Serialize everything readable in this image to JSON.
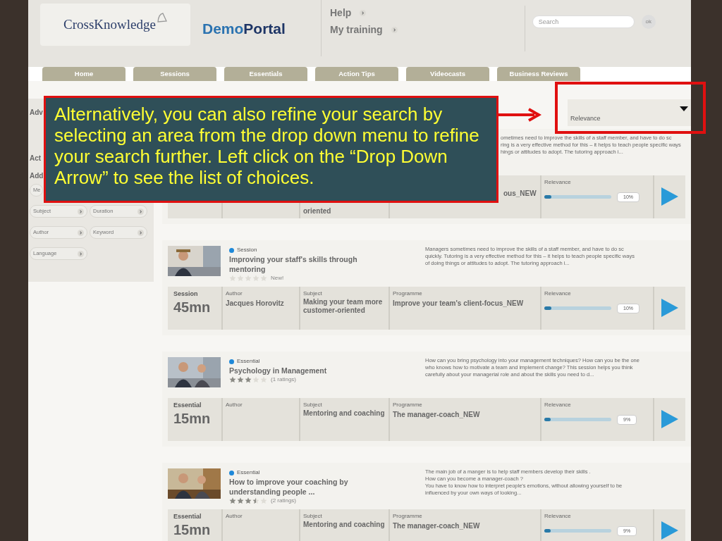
{
  "header": {
    "logo": "CrossKnowledge",
    "portal_name": [
      "Demo",
      "Portal"
    ],
    "links": [
      "Help",
      "My training"
    ],
    "search": {
      "placeholder": "Search"
    },
    "search_button": "ok"
  },
  "tabs": [
    {
      "label": "Home"
    },
    {
      "label": "Sessions"
    },
    {
      "label": "Essentials"
    },
    {
      "label": "Action Tips"
    },
    {
      "label": "Videocasts"
    },
    {
      "label": "Business Reviews"
    }
  ],
  "sidebar": {
    "headings": [
      "Adv",
      "Act",
      "Add"
    ],
    "filters": [
      [
        "Me"
      ],
      [
        "Subject",
        "Duration"
      ],
      [
        "Author",
        "Keyword"
      ],
      [
        "Language"
      ]
    ]
  },
  "sort": {
    "value": "Relevance"
  },
  "callout": "Alternatively, you can also refine your search by selecting an area from the drop down menu to refine your search further. Left click on the “Drop Down Arrow” to see the list of choices.",
  "results": [
    {
      "covered": true,
      "description": [
        "ometimes need to improve the skills of a staff member, and have to do sc",
        "ring is a very effective method for this – it helps to teach people specific ways",
        "hings or attitudes to adopt. The tutoring approach i..."
      ],
      "subject": "oriented",
      "programme": "ous_NEW",
      "relevance_label": "Relevance",
      "relevance": "10%",
      "level": 0.1
    },
    {
      "covered": false,
      "type_label": "Session",
      "title": "Improving your staff's skills through mentoring",
      "stars": 0,
      "rating_text": "New!",
      "description": [
        "Managers sometimes need to improve the skills of a staff member, and have to do sc",
        "quickly. Tutoring is a very effective method for this – it helps to teach people specific ways",
        "of doing things or attitudes to adopt. The tutoring approach i..."
      ],
      "kind_label": "Session",
      "duration": "45mn",
      "author_label": "Author",
      "author": "Jacques Horovitz",
      "subject_label": "Subject",
      "subject": "Making your team more customer-oriented",
      "programme_label": "Programme",
      "programme": "Improve your team's client-focus_NEW",
      "relevance_label": "Relevance",
      "relevance": "10%",
      "level": 0.1
    },
    {
      "covered": false,
      "type_label": "Essential",
      "title": "Psychology in Management",
      "stars": 3,
      "rating_text": "(1 ratings)",
      "description": [
        "How can you bring psychology into your management techniques? How can you be the one",
        "who knows how to motivate a team and implement change? This session helps you think",
        "carefully about your managerial role and about the skills you need to d..."
      ],
      "kind_label": "Essential",
      "duration": "15mn",
      "author_label": "Author",
      "subject_label": "Subject",
      "subject": "Mentoring and coaching",
      "programme_label": "Programme",
      "programme": "The manager-coach_NEW",
      "relevance_label": "Relevance",
      "relevance": "9%",
      "level": 0.09
    },
    {
      "covered": false,
      "type_label": "Essential",
      "title": "How to improve your coaching by understanding people ...",
      "stars": 3.5,
      "rating_text": "(2 ratings)",
      "description": [
        "The main job of a manger is to help staff members develop their skills .",
        "How can you become a manager-coach ?",
        "You have to know how to interpret people's emotions, without allowing yourself to be",
        "influenced by your own ways of looking..."
      ],
      "kind_label": "Essential",
      "duration": "15mn",
      "author_label": "Author",
      "subject_label": "Subject",
      "subject": "Mentoring and coaching",
      "programme_label": "Programme",
      "programme": "The manager-coach_NEW",
      "relevance_label": "Relevance",
      "relevance": "9%",
      "level": 0.09
    }
  ]
}
